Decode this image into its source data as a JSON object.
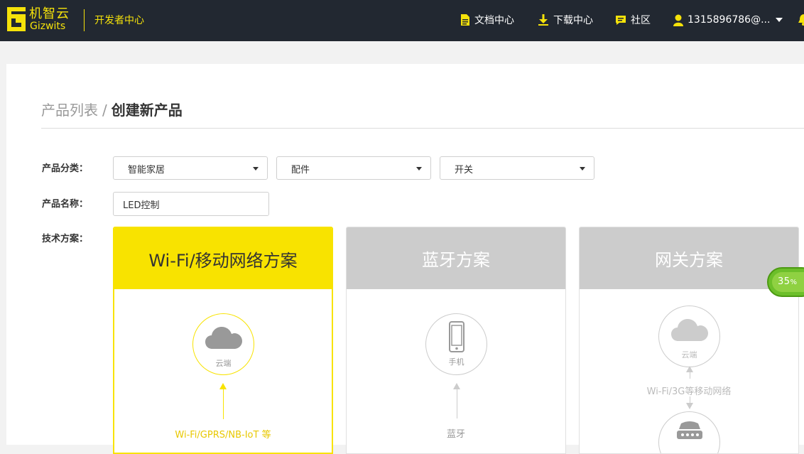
{
  "header": {
    "logo_cn": "机智云",
    "logo_en": "Gizwits",
    "portal_title": "开发者中心",
    "nav": {
      "docs": "文档中心",
      "download": "下载中心",
      "community": "社区",
      "user": "1315896786@..."
    }
  },
  "breadcrumb": {
    "parent": "产品列表",
    "separator": "/",
    "current": "创建新产品"
  },
  "form": {
    "category_label": "产品分类：",
    "category_selects": [
      "智能家居",
      "配件",
      "开关"
    ],
    "name_label": "产品名称：",
    "name_value": "LED控制",
    "scheme_label": "技术方案："
  },
  "schemes": {
    "wifi": {
      "title": "Wi-Fi/移动网络方案",
      "cloud_label": "云端",
      "link_label": "Wi-Fi/GPRS/NB-IoT 等"
    },
    "bluetooth": {
      "title": "蓝牙方案",
      "phone_label": "手机",
      "link_label": "蓝牙"
    },
    "gateway": {
      "title": "网关方案",
      "cloud_label": "云端",
      "link_label": "Wi-Fi/3G等移动网络"
    }
  },
  "float_badge": {
    "percent": "35",
    "unit": "%"
  },
  "colors": {
    "topbar": "#222831",
    "accent": "#f8e300",
    "inactive_header": "#cccccc",
    "badge": "#6cbf2a"
  }
}
